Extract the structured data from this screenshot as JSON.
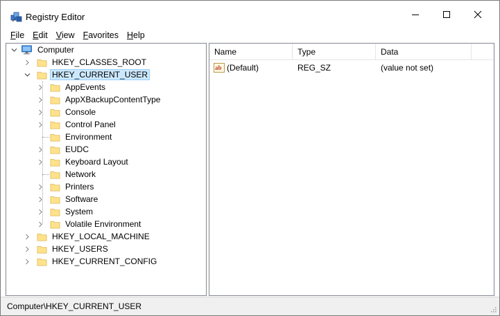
{
  "window": {
    "title": "Registry Editor",
    "controls": {
      "minimize": "minimize",
      "maximize": "maximize",
      "close": "close"
    }
  },
  "menu": [
    {
      "underline": "F",
      "rest": "ile"
    },
    {
      "underline": "E",
      "rest": "dit"
    },
    {
      "underline": "V",
      "rest": "iew"
    },
    {
      "underline": "F",
      "rest": "avorites",
      "prefix": ""
    },
    {
      "underline": "H",
      "rest": "elp"
    }
  ],
  "tree": {
    "root": {
      "label": "Computer",
      "expanded": true
    },
    "hives": [
      {
        "label": "HKEY_CLASSES_ROOT",
        "expanded": false
      },
      {
        "label": "HKEY_CURRENT_USER",
        "expanded": true,
        "selected": true
      },
      {
        "label": "HKEY_LOCAL_MACHINE",
        "expanded": false
      },
      {
        "label": "HKEY_USERS",
        "expanded": false
      },
      {
        "label": "HKEY_CURRENT_CONFIG",
        "expanded": false
      }
    ],
    "children": [
      {
        "label": "AppEvents",
        "has_children": true
      },
      {
        "label": "AppXBackupContentType",
        "has_children": true
      },
      {
        "label": "Console",
        "has_children": true
      },
      {
        "label": "Control Panel",
        "has_children": true
      },
      {
        "label": "Environment",
        "has_children": false
      },
      {
        "label": "EUDC",
        "has_children": true
      },
      {
        "label": "Keyboard Layout",
        "has_children": true
      },
      {
        "label": "Network",
        "has_children": false
      },
      {
        "label": "Printers",
        "has_children": true
      },
      {
        "label": "Software",
        "has_children": true
      },
      {
        "label": "System",
        "has_children": true
      },
      {
        "label": "Volatile Environment",
        "has_children": true
      }
    ]
  },
  "list": {
    "columns": [
      "Name",
      "Type",
      "Data"
    ],
    "rows": [
      {
        "icon": "string-value-icon",
        "name": "(Default)",
        "type": "REG_SZ",
        "data": "(value not set)"
      }
    ]
  },
  "status": {
    "path": "Computer\\HKEY_CURRENT_USER"
  },
  "colors": {
    "folder": "#ffe28a",
    "selection": "#cce8ff",
    "selection_border": "#99d1ff",
    "monitor": "#2b7bd6"
  }
}
